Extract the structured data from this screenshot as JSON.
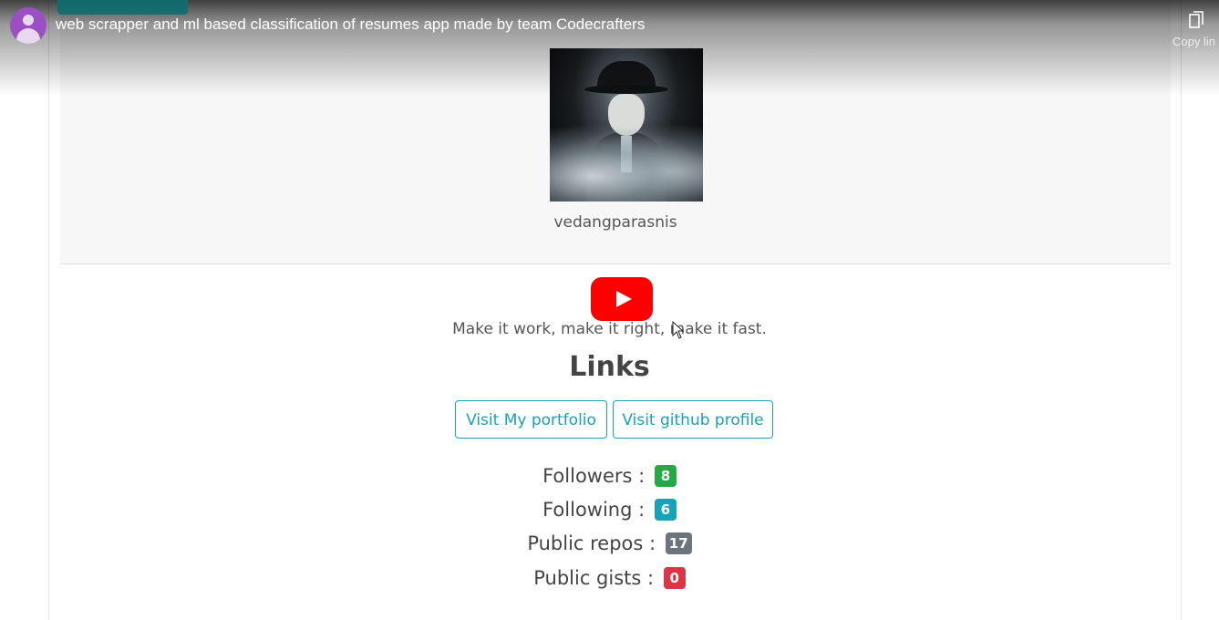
{
  "video": {
    "title": "web scrapper and ml based classification of resumes app made by team Codecrafters",
    "copy_link_label": "Copy lin",
    "channel_avatar_color": "#9b4fc3"
  },
  "profile": {
    "username": "vedangparasnis",
    "bio": "Make it work, make it right, make it fast.",
    "links_heading": "Links",
    "buttons": {
      "portfolio": "Visit My portfolio",
      "github": "Visit github profile"
    },
    "stats": [
      {
        "label": "Followers :",
        "value": "8",
        "color": "#28a745"
      },
      {
        "label": "Following :",
        "value": "6",
        "color": "#17a2b8"
      },
      {
        "label": "Public repos :",
        "value": "17",
        "color": "#6c757d"
      },
      {
        "label": "Public gists :",
        "value": "0",
        "color": "#dc3545"
      }
    ]
  },
  "colors": {
    "accent": "#17a2b8",
    "play_button": "#ff0000"
  },
  "icons": {
    "play": "play-icon",
    "copy": "copy-icon",
    "cursor": "mouse-cursor-icon"
  }
}
